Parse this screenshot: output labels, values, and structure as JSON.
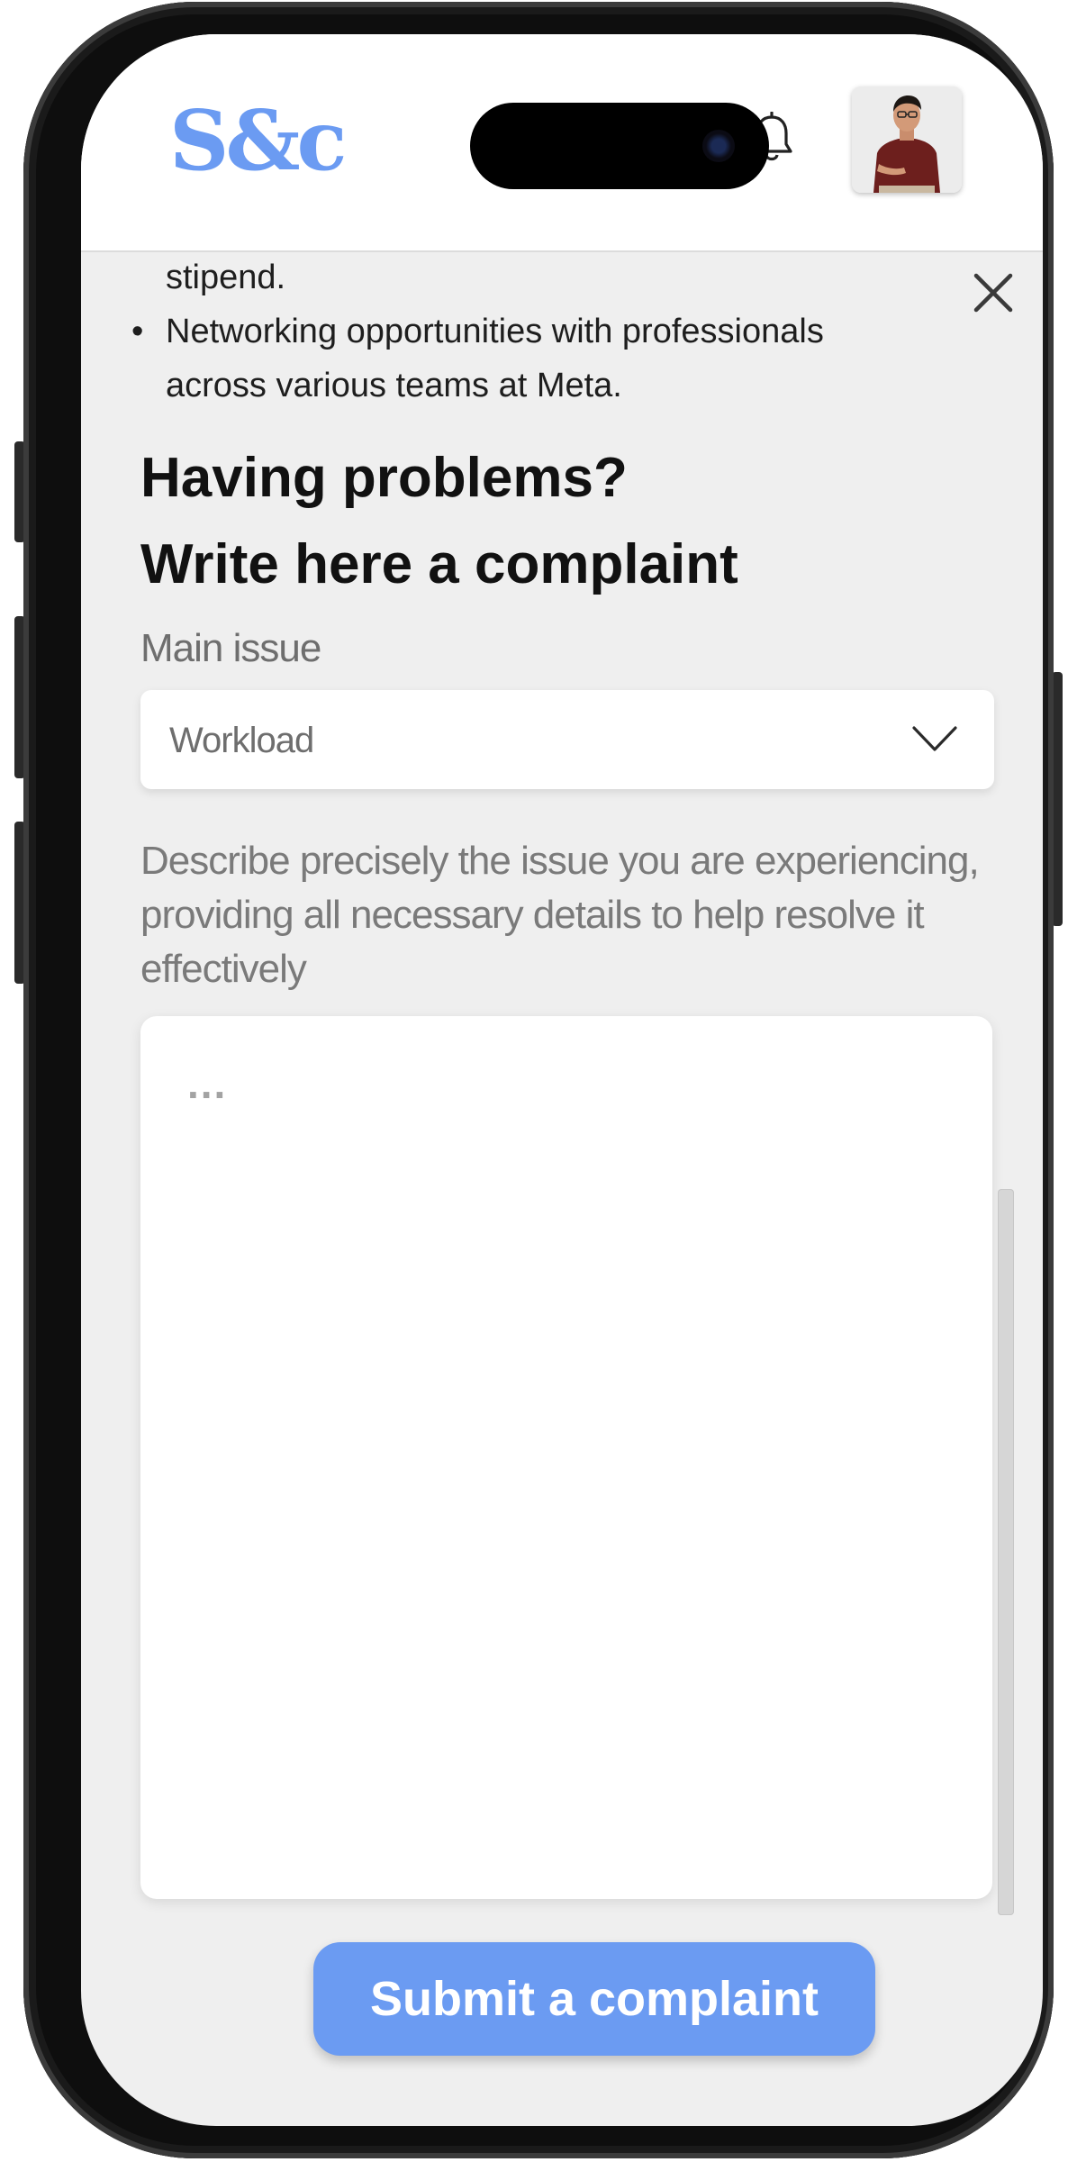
{
  "app": {
    "logo_text": "S&c",
    "brand_color": "#6b9bf2"
  },
  "header": {
    "bell_icon": "bell-icon",
    "avatar_icon": "user-avatar"
  },
  "benefits": {
    "fragment": "stipend.",
    "bullet_line1": "Networking opportunities with professionals",
    "bullet_line2": "across various teams at Meta."
  },
  "complaint": {
    "title_line1": "Having problems?",
    "title_line2": "Write here a complaint",
    "main_issue_label": "Main issue",
    "main_issue_value": "Workload",
    "description_label": "Describe precisely the issue you are experiencing, providing all necessary details to help resolve it effectively",
    "textarea_placeholder": "...",
    "submit_label": "Submit a complaint"
  }
}
